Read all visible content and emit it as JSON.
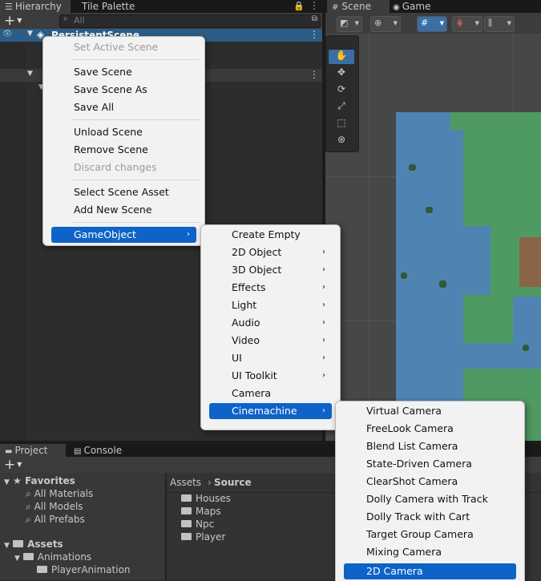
{
  "hierarchy": {
    "tabs": [
      "Hierarchy",
      "Tile Palette"
    ],
    "search_placeholder": "All",
    "scenes": [
      "PersistentScene"
    ]
  },
  "scene_view": {
    "tabs": [
      "Scene",
      "Game"
    ]
  },
  "context_menu": {
    "items": [
      {
        "label": "Set Active Scene",
        "enabled": false
      },
      {
        "label": "Save Scene",
        "enabled": true
      },
      {
        "label": "Save Scene As",
        "enabled": true
      },
      {
        "label": "Save All",
        "enabled": true
      },
      {
        "label": "Unload Scene",
        "enabled": true
      },
      {
        "label": "Remove Scene",
        "enabled": true
      },
      {
        "label": "Discard changes",
        "enabled": false
      },
      {
        "label": "Select Scene Asset",
        "enabled": true
      },
      {
        "label": "Add New Scene",
        "enabled": true
      },
      {
        "label": "GameObject",
        "enabled": true,
        "submenu": true,
        "selected": true
      }
    ]
  },
  "gameobject_menu": {
    "items": [
      {
        "label": "Create Empty",
        "submenu": false
      },
      {
        "label": "2D Object",
        "submenu": true
      },
      {
        "label": "3D Object",
        "submenu": true
      },
      {
        "label": "Effects",
        "submenu": true
      },
      {
        "label": "Light",
        "submenu": true
      },
      {
        "label": "Audio",
        "submenu": true
      },
      {
        "label": "Video",
        "submenu": true
      },
      {
        "label": "UI",
        "submenu": true
      },
      {
        "label": "UI Toolkit",
        "submenu": true
      },
      {
        "label": "Camera",
        "submenu": false
      },
      {
        "label": "Cinemachine",
        "submenu": true,
        "selected": true
      }
    ]
  },
  "cinemachine_menu": {
    "items": [
      {
        "label": "Virtual Camera"
      },
      {
        "label": "FreeLook Camera"
      },
      {
        "label": "Blend List Camera"
      },
      {
        "label": "State-Driven Camera"
      },
      {
        "label": "ClearShot Camera"
      },
      {
        "label": "Dolly Camera with Track"
      },
      {
        "label": "Dolly Track with Cart"
      },
      {
        "label": "Target Group Camera"
      },
      {
        "label": "Mixing Camera"
      },
      {
        "label": "2D Camera",
        "selected": true
      }
    ]
  },
  "project": {
    "tabs": [
      "Project",
      "Console"
    ],
    "favorites_label": "Favorites",
    "favorites": [
      "All Materials",
      "All Models",
      "All Prefabs"
    ],
    "assets_label": "Assets",
    "asset_tree": [
      "Animations",
      "PlayerAnimation"
    ],
    "breadcrumb": [
      "Assets",
      "Source"
    ],
    "folders": [
      "Houses",
      "Maps",
      "Npc",
      "Player"
    ]
  },
  "colors": {
    "accent": "#0e63c8",
    "water": "#4f83b2",
    "grass": "#4f9a62",
    "dirt": "#8a6446"
  }
}
